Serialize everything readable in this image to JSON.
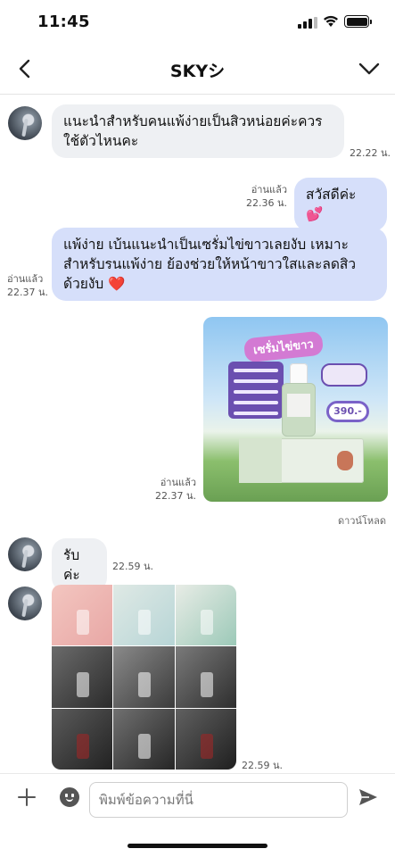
{
  "status_bar": {
    "time": "11:45"
  },
  "header": {
    "title": "SKYシ"
  },
  "messages": [
    {
      "text": "แนะนำสำหรับคนแพ้ง่ายเป็นสิวหน่อยค่ะควร ใช้ตัวไหนคะ",
      "time": "22.22 น."
    },
    {
      "text": "สวัสดีค่ะ",
      "emoji": "💕",
      "read": "อ่านแล้ว",
      "time": "22.36 น."
    },
    {
      "text": "แพ้ง่าย เบ้นแนะนำเป็นเซรั่มไข่ขาวเลยงับ เหมาะสำหรับรนแพ้ง่าย ย้องช่วยให้หน้าขาวใสและลดสิวด้วยงับ",
      "emoji": "❤️",
      "read": "อ่านแล้ว",
      "time": "22.37 น."
    },
    {
      "image_headline": "เซรั่มไข่ขาว",
      "price": "390.-",
      "read": "อ่านแล้ว",
      "time": "22.37 น.",
      "download": "ดาวน์โหลด"
    },
    {
      "text": "รับค่ะ",
      "time": "22.59 น."
    },
    {
      "image": "collage",
      "time": "22.59 น."
    }
  ],
  "input": {
    "placeholder": "พิมพ์ข้อความที่นี่"
  }
}
